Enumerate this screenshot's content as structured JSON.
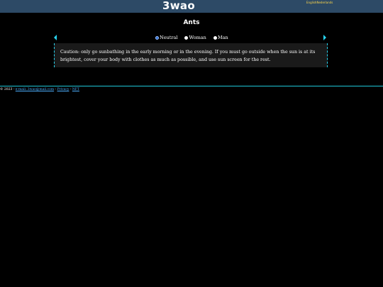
{
  "header": {
    "logo": "3wao",
    "languages": [
      "English",
      "Nederlands"
    ]
  },
  "page": {
    "title": "Ants"
  },
  "nav": {
    "prev_icon": "arrow-left-icon",
    "next_icon": "arrow-right-icon"
  },
  "gender": {
    "options": [
      "Neutral",
      "Woman",
      "Man"
    ],
    "selected": "Neutral"
  },
  "content": {
    "text": "Caution: only go sunbathing in the early morning or in the evening. If you must go outside when the sun is at its brightest, cover your body with clothes as much as possible, and use sun screen for the rest."
  },
  "footer": {
    "copyright": "© 2023 -",
    "email": "e-mail: 3wao@mail.com",
    "sep1": "-",
    "privacy": "Privacy",
    "sep2": "-",
    "nft": "NFT"
  },
  "colors": {
    "topbar": "#2d4a66",
    "accent": "#28d4f0",
    "language_text": "#ffd84a",
    "link": "#4db0ff",
    "content_bg": "#1a1a1a"
  }
}
